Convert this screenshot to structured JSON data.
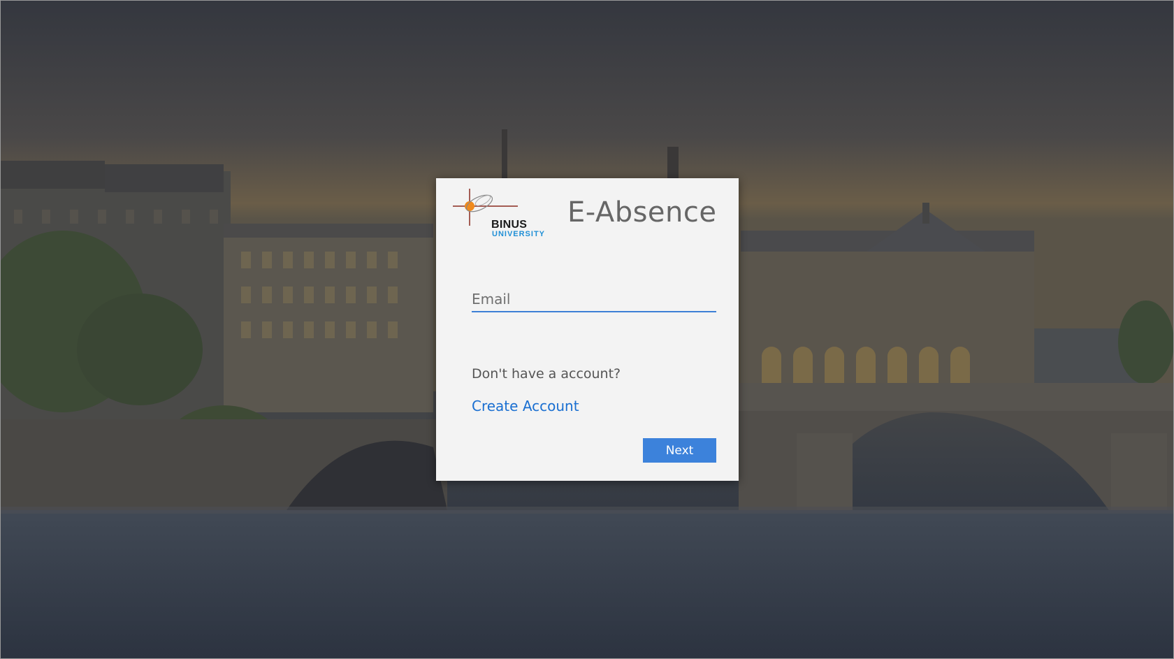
{
  "app": {
    "title": "E-Absence"
  },
  "logo": {
    "line1": "BINUS",
    "line2": "UNIVERSITY"
  },
  "form": {
    "email_placeholder": "Email",
    "email_value": "",
    "no_account_text": "Don't have a account?",
    "create_account_label": "Create Account",
    "next_label": "Next"
  },
  "colors": {
    "accent": "#3c82db",
    "link": "#1a6fd1",
    "card_bg": "#f3f3f3",
    "title_text": "#666666"
  }
}
